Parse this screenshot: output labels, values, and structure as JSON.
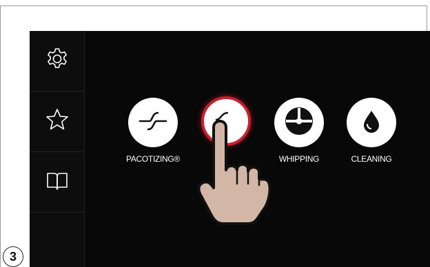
{
  "sidebar": {
    "items": [
      {
        "icon": "gear-icon"
      },
      {
        "icon": "star-icon"
      },
      {
        "icon": "book-icon"
      }
    ]
  },
  "modes": [
    {
      "label": "PACOTIZING®",
      "icon": "pacotizing-blade-icon",
      "active": false
    },
    {
      "label": "",
      "icon": "pacotizing-blade-icon",
      "active": true
    },
    {
      "label": "WHIPPING",
      "icon": "whipping-icon",
      "active": false
    },
    {
      "label": "CLEANING",
      "icon": "droplet-icon",
      "active": false
    }
  ],
  "step_badge": "3",
  "colors": {
    "accent": "#c8202c",
    "screen_bg": "#080808",
    "button_bg": "#ffffff"
  }
}
